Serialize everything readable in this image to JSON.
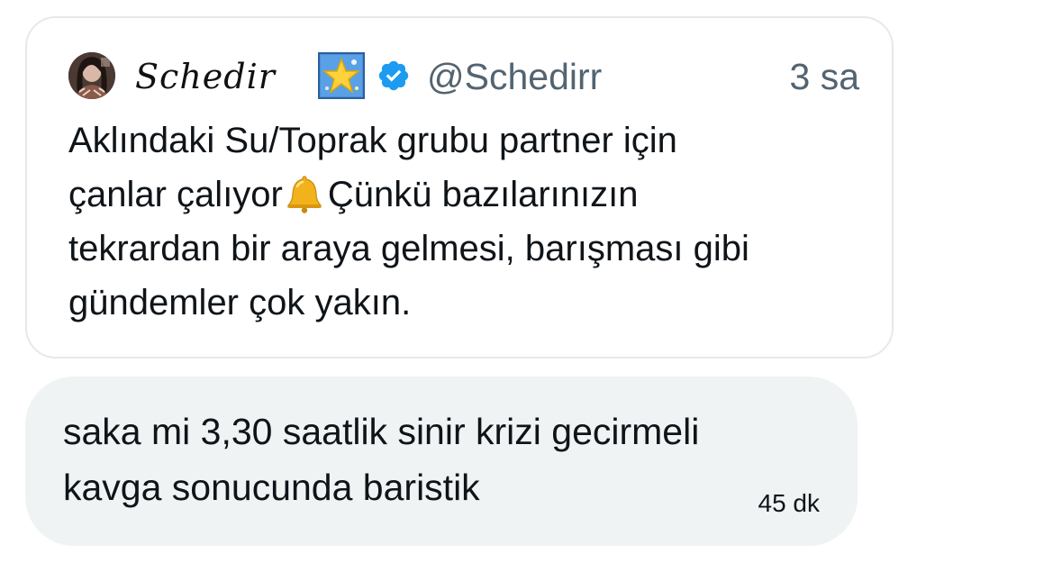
{
  "quoted_post": {
    "author_name": "Schedir",
    "author_badge_icon": "glowing-star-icon",
    "verified_icon": "verified-badge-icon",
    "handle": "@Schedirr",
    "time": "3 sa",
    "body_lines": [
      "Aklındaki Su/Toprak grubu partner için",
      "çanlar çalıyor",
      "Çünkü bazılarınızın",
      "tekrardan bir araya gelmesi, barışması gibi",
      "gündemler çok yakın."
    ],
    "inline_icon": "bell-icon"
  },
  "message": {
    "lines": [
      "saka mi 3,30 saatlik sinir krizi gecirmeli",
      "kavga sonucunda baristik"
    ],
    "time": "45 dk"
  },
  "colors": {
    "text_primary": "#0f1419",
    "text_secondary": "#536471",
    "verified_blue": "#1d9bf0",
    "bubble_background": "#eff3f4",
    "card_border": "#e6e8ea"
  }
}
